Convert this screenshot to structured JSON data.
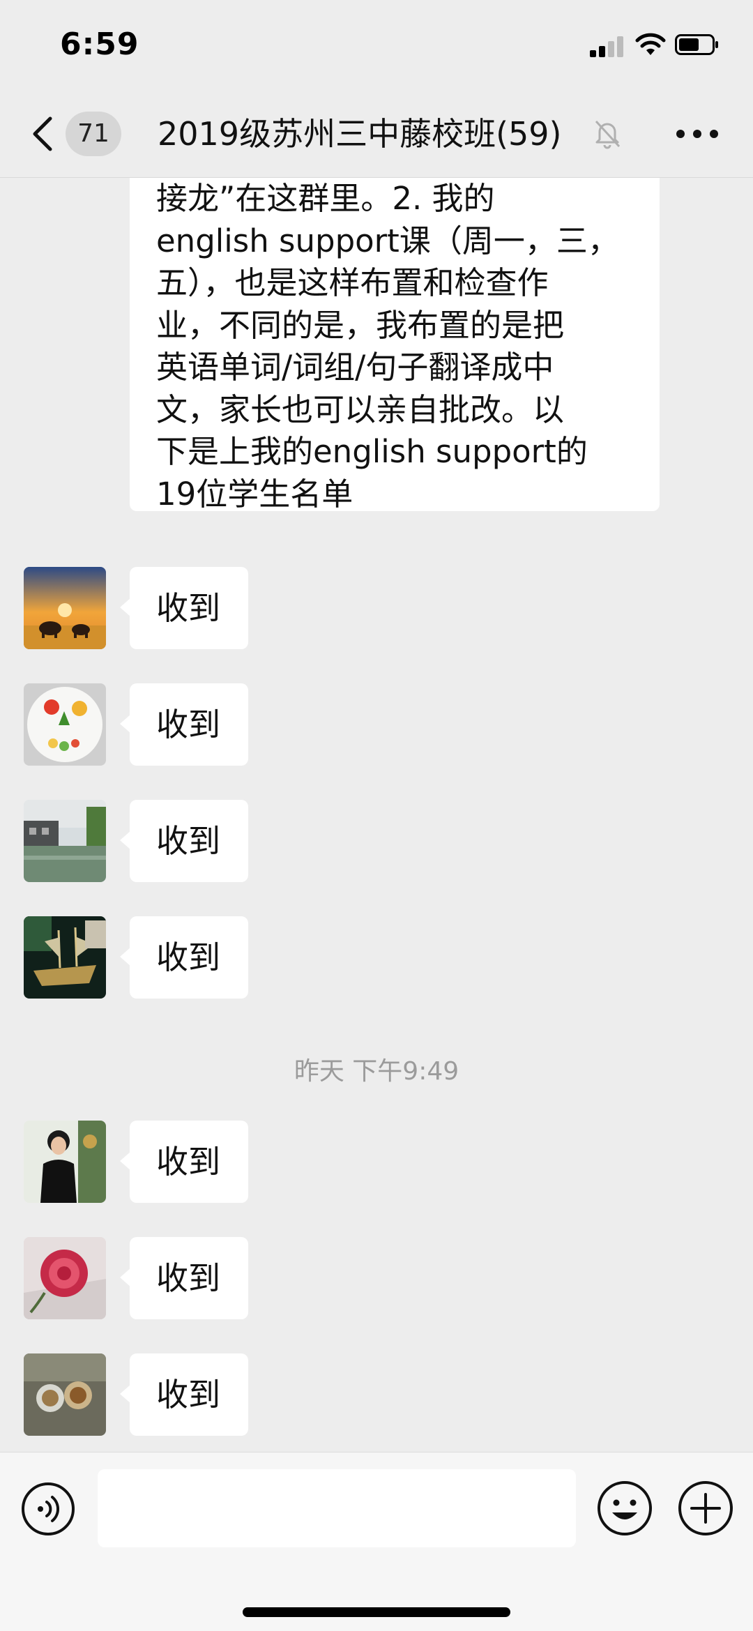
{
  "status_bar": {
    "time": "6:59"
  },
  "header": {
    "back_count": "71",
    "title": "2019级苏州三中藤校班(59)"
  },
  "messages": {
    "long_text": "接龙”在这群里。2. 我的\nenglish support课（周一，三，\n五），也是这样布置和检查作\n业，不同的是，我布置的是把\n英语单词/词组/句子翻译成中\n文，家长也可以亲自批改。以\n下是上我的english support的\n19位学生名单",
    "reply_1": "收到",
    "reply_2": "收到",
    "reply_3": "收到",
    "reply_4": "收到",
    "timestamp": "昨天 下午9:49",
    "reply_5": "收到",
    "reply_6": "收到",
    "reply_7": "收到"
  },
  "input_bar": {
    "placeholder": ""
  },
  "icons": {
    "back": "chevron-left-icon",
    "mute": "bell-slash-icon",
    "more": "more-dots-icon",
    "voice": "voice-icon",
    "emoji": "emoji-icon",
    "plus": "plus-icon"
  }
}
